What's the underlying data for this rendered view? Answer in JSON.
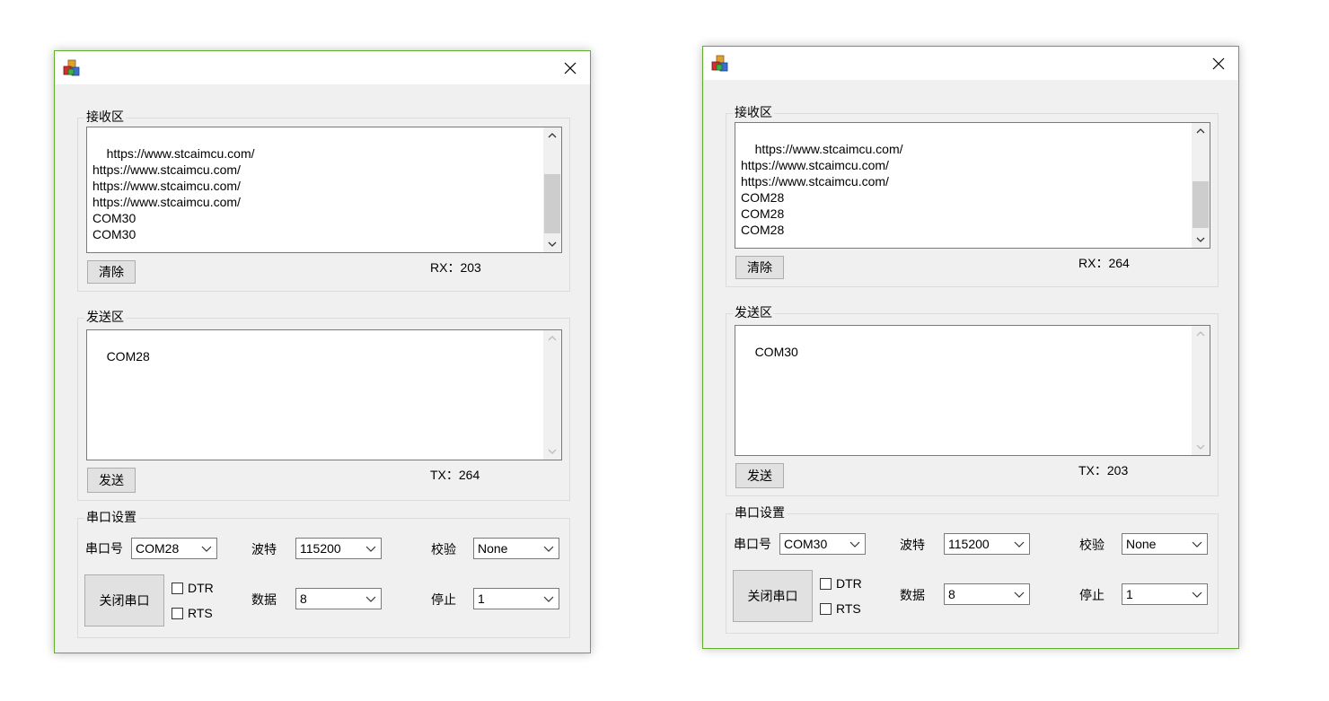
{
  "windows": [
    {
      "receive": {
        "title": "接收区",
        "lines": "https://www.stcaimcu.com/\nhttps://www.stcaimcu.com/\nhttps://www.stcaimcu.com/\nhttps://www.stcaimcu.com/\nCOM30\nCOM30",
        "clear_label": "清除",
        "rx_count": "RX：203"
      },
      "send": {
        "title": "发送区",
        "text": "COM28",
        "send_label": "发送",
        "tx_count": "TX：264"
      },
      "settings": {
        "title": "串口设置",
        "port_label": "串口号",
        "port_value": "COM28",
        "baud_label": "波特",
        "baud_value": "115200",
        "parity_label": "校验",
        "parity_value": "None",
        "data_label": "数据",
        "data_value": "8",
        "stop_label": "停止",
        "stop_value": "1",
        "close_port_label": "关闭串口",
        "dtr_label": "DTR",
        "rts_label": "RTS"
      }
    },
    {
      "receive": {
        "title": "接收区",
        "lines": "https://www.stcaimcu.com/\nhttps://www.stcaimcu.com/\nhttps://www.stcaimcu.com/\nCOM28\nCOM28\nCOM28",
        "clear_label": "清除",
        "rx_count": "RX：264"
      },
      "send": {
        "title": "发送区",
        "text": "COM30",
        "send_label": "发送",
        "tx_count": "TX：203"
      },
      "settings": {
        "title": "串口设置",
        "port_label": "串口号",
        "port_value": "COM30",
        "baud_label": "波特",
        "baud_value": "115200",
        "parity_label": "校验",
        "parity_value": "None",
        "data_label": "数据",
        "data_value": "8",
        "stop_label": "停止",
        "stop_value": "1",
        "close_port_label": "关闭串口",
        "dtr_label": "DTR",
        "rts_label": "RTS"
      }
    }
  ]
}
